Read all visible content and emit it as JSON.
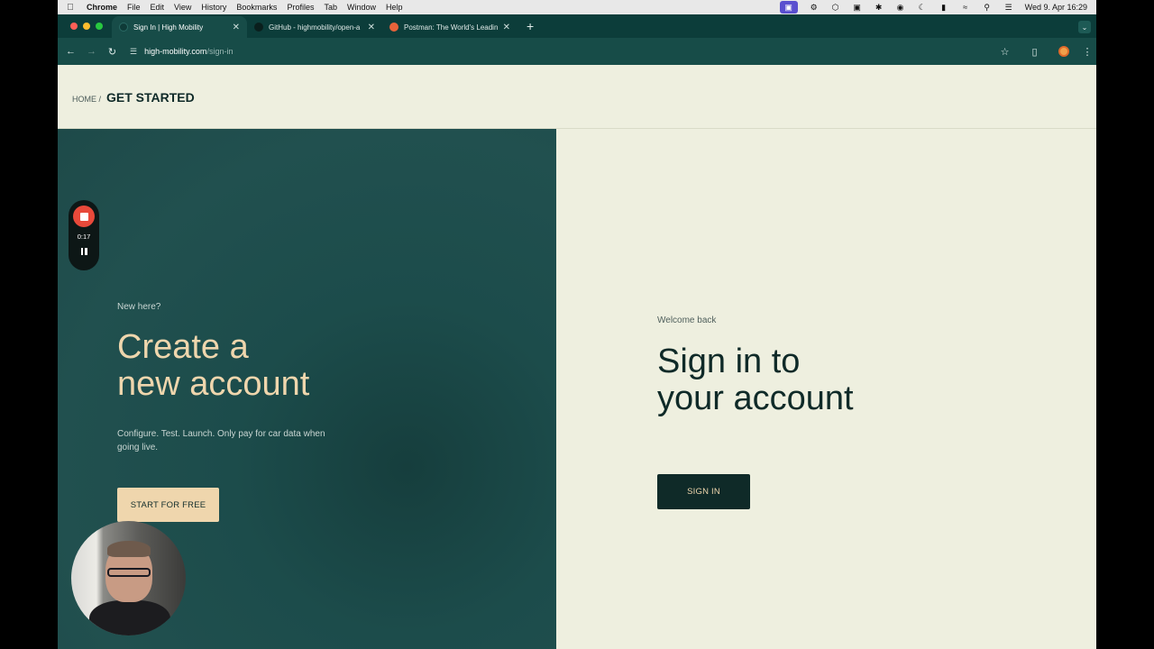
{
  "menubar": {
    "app": "Chrome",
    "items": [
      "File",
      "Edit",
      "View",
      "History",
      "Bookmarks",
      "Profiles",
      "Tab",
      "Window",
      "Help"
    ],
    "clock": "Wed 9. Apr  16:29"
  },
  "tabs": [
    {
      "title": "Sign In | High Mobility",
      "active": true
    },
    {
      "title": "GitHub - highmobility/open-a",
      "active": false
    },
    {
      "title": "Postman: The World's Leading",
      "active": false
    }
  ],
  "url": {
    "host": "high-mobility.com",
    "path": "/sign-in"
  },
  "breadcrumb": {
    "home": "HOME /",
    "current": "GET STARTED"
  },
  "create": {
    "eyebrow": "New here?",
    "title_line1": "Create a",
    "title_line2": "new account",
    "subtitle": "Configure. Test. Launch. Only pay for car data when going live.",
    "button": "START FOR FREE"
  },
  "signin": {
    "eyebrow": "Welcome back",
    "title_line1": "Sign in to",
    "title_line2": "your account",
    "button": "SIGN IN"
  },
  "recorder": {
    "time": "0:17"
  },
  "colors": {
    "brand_dark": "#0f2a28",
    "brand_teal": "#1e4a49",
    "accent_cream": "#efd6ad",
    "page_bg": "#eeefdf",
    "record_red": "#e8493a"
  }
}
